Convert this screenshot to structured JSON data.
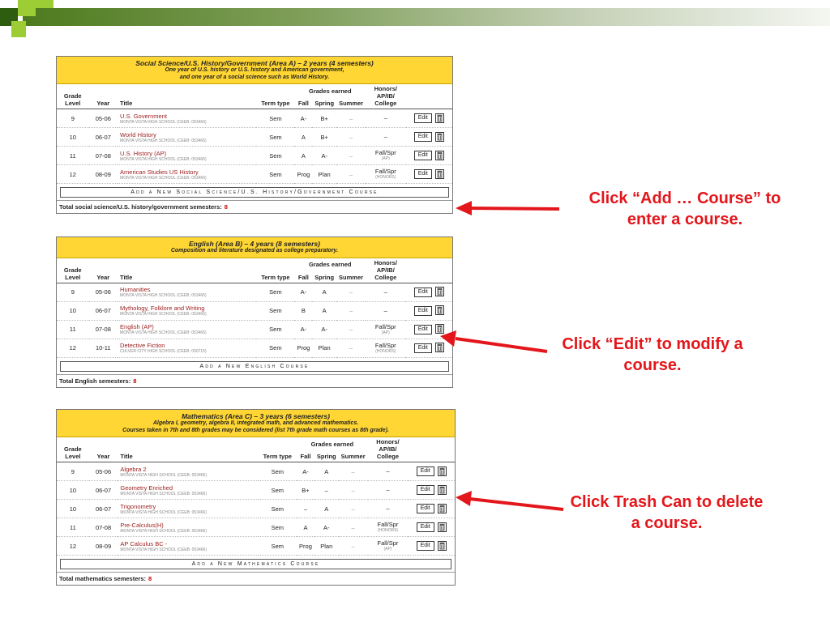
{
  "columns": {
    "grade_level": "Grade Level",
    "year": "Year",
    "title": "Title",
    "term_type": "Term type",
    "grades_earned": "Grades earned",
    "fall": "Fall",
    "spring": "Spring",
    "summer": "Summer",
    "honors": "Honors/ AP/IB/ College"
  },
  "buttons": {
    "edit": "Edit"
  },
  "sections": [
    {
      "title": "Social Science/U.S. History/Government (Area A) – 2 years (4 semesters)",
      "subtitle": [
        "One year of U.S. history or U.S. history and American government,",
        "and one year of a social science such as World History."
      ],
      "rows": [
        {
          "grade": "9",
          "year": "05-06",
          "course": "U.S. Government",
          "school": "MONTA VISTA HIGH SCHOOL (CEEB: 053466)",
          "term": "Sem",
          "fall": "A-",
          "spring": "B+",
          "summer": "–",
          "honors": "–",
          "honors_sub": ""
        },
        {
          "grade": "10",
          "year": "06-07",
          "course": "World History",
          "school": "MONTA VISTA HIGH SCHOOL (CEEB: 053466)",
          "term": "Sem",
          "fall": "A",
          "spring": "B+",
          "summer": "–",
          "honors": "–",
          "honors_sub": ""
        },
        {
          "grade": "11",
          "year": "07-08",
          "course": "U.S. History (AP)",
          "school": "MONTA VISTA HIGH SCHOOL (CEEB: 053466)",
          "term": "Sem",
          "fall": "A",
          "spring": "A-",
          "summer": "–",
          "honors": "Fall/Spr",
          "honors_sub": "(AP)"
        },
        {
          "grade": "12",
          "year": "08-09",
          "course": "American Studies US History",
          "school": "MONTA VISTA HIGH SCHOOL (CEEB: 053466)",
          "term": "Sem",
          "fall": "Prog",
          "spring": "Plan",
          "summer": "–",
          "honors": "Fall/Spr",
          "honors_sub": "(HONORS)"
        }
      ],
      "add_label": "Add a New Social Science/U.S. History/Government Course",
      "total_label": "Total social science/U.S. history/government semesters:",
      "total_value": "8"
    },
    {
      "title": "English (Area B) – 4 years (8 semesters)",
      "subtitle": [
        "Composition and literature designated as college preparatory."
      ],
      "rows": [
        {
          "grade": "9",
          "year": "05-06",
          "course": "Humanities",
          "school": "MONTA VISTA HIGH SCHOOL (CEEB: 053466)",
          "term": "Sem",
          "fall": "A-",
          "spring": "A",
          "summer": "–",
          "honors": "–",
          "honors_sub": ""
        },
        {
          "grade": "10",
          "year": "06-07",
          "course": "Mythology, Folklore and Writing",
          "school": "MONTA VISTA HIGH SCHOOL (CEEB: 053466)",
          "term": "Sem",
          "fall": "B",
          "spring": "A",
          "summer": "–",
          "honors": "–",
          "honors_sub": ""
        },
        {
          "grade": "11",
          "year": "07-08",
          "course": "English (AP)",
          "school": "MONTA VISTA HIGH SCHOOL (CEEB: 053466)",
          "term": "Sem",
          "fall": "A-",
          "spring": "A-",
          "summer": "–",
          "honors": "Fall/Spr",
          "honors_sub": "(AP)"
        },
        {
          "grade": "12",
          "year": "10-11",
          "course": "Detective Fiction",
          "school": "CULVER CITY HIGH SCHOOL (CEEB: 050715)",
          "term": "Sem",
          "fall": "Prog",
          "spring": "Plan",
          "summer": "–",
          "honors": "Fall/Spr",
          "honors_sub": "(HONORS)"
        }
      ],
      "add_label": "Add a New English Course",
      "total_label": "Total English semesters:",
      "total_value": "8"
    },
    {
      "title": "Mathematics (Area C) – 3 years (6 semesters)",
      "subtitle": [
        "Algebra I, geometry, algebra II, integrated math, and advanced mathematics.",
        "Courses taken in 7th and 8th grades may be considered (list 7th grade math courses as 8th grade)."
      ],
      "rows": [
        {
          "grade": "9",
          "year": "05-06",
          "course": "Algebra 2",
          "school": "MONTA VISTA HIGH SCHOOL (CEEB: 053466)",
          "term": "Sem",
          "fall": "A-",
          "spring": "A",
          "summer": "–",
          "honors": "–",
          "honors_sub": ""
        },
        {
          "grade": "10",
          "year": "06-07",
          "course": "Geometry Enriched",
          "school": "MONTA VISTA HIGH SCHOOL (CEEB: 053466)",
          "term": "Sem",
          "fall": "B+",
          "spring": "–",
          "summer": "–",
          "honors": "–",
          "honors_sub": ""
        },
        {
          "grade": "10",
          "year": "06-07",
          "course": "Trigonometry",
          "school": "MONTA VISTA HIGH SCHOOL (CEEB: 053466)",
          "term": "Sem",
          "fall": "–",
          "spring": "A",
          "summer": "–",
          "honors": "–",
          "honors_sub": ""
        },
        {
          "grade": "11",
          "year": "07-08",
          "course": "Pre-Calculus(H)",
          "school": "MONTA VISTA HIGH SCHOOL (CEEB: 053466)",
          "term": "Sem",
          "fall": "A",
          "spring": "A-",
          "summer": "–",
          "honors": "Fall/Spr",
          "honors_sub": "(HONORS)"
        },
        {
          "grade": "12",
          "year": "08-09",
          "course": "AP Calculus BC -",
          "school": "MONTA VISTA HIGH SCHOOL (CEEB: 053466)",
          "term": "Sem",
          "fall": "Prog",
          "spring": "Plan",
          "summer": "–",
          "honors": "Fall/Spr",
          "honors_sub": "(AP)"
        }
      ],
      "add_label": "Add a New Mathematics Course",
      "total_label": "Total mathematics semesters:",
      "total_value": "8"
    }
  ],
  "callouts": {
    "add": "Click “Add … Course” to enter a course.",
    "edit": "Click “Edit” to modify a course.",
    "trash": "Click Trash Can to delete a course."
  },
  "colors": {
    "accent_red": "#e3161b",
    "header_yellow": "#ffd633",
    "title_green": "#4e7a1e"
  }
}
